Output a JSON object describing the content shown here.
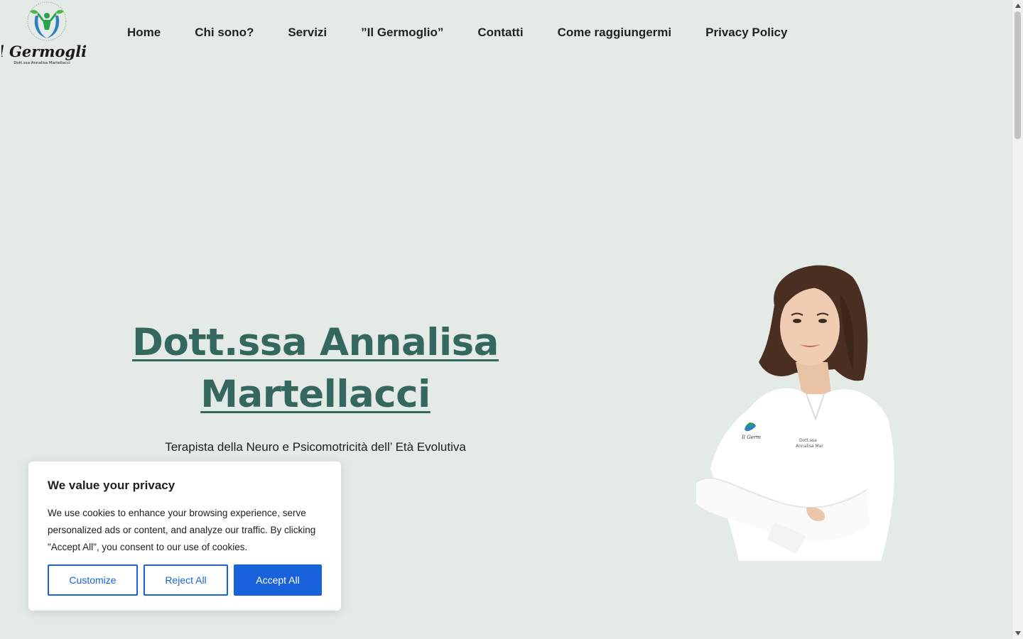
{
  "logo": {
    "title": "Il Germoglio",
    "subtitle": "Dott.ssa Annalisa Martellacci"
  },
  "nav": {
    "items": [
      {
        "label": "Home"
      },
      {
        "label": "Chi sono?"
      },
      {
        "label": "Servizi"
      },
      {
        "label": "”Il Germoglio”"
      },
      {
        "label": "Contatti"
      },
      {
        "label": "Come raggiungermi"
      },
      {
        "label": "Privacy Policy"
      }
    ]
  },
  "hero": {
    "title": "Dott.ssa Annalisa Martellacci",
    "subtitle": "Terapista della Neuro e Psicomotricità dell’ Età Evolutiva"
  },
  "cookie": {
    "title": "We value your privacy",
    "text": "We use cookies to enhance your browsing experience, serve personalized ads or content, and analyze our traffic. By clicking \"Accept All\", you consent to our use of cookies.",
    "customize": "Customize",
    "reject": "Reject All",
    "accept": "Accept All"
  },
  "colors": {
    "background": "#e4ebe7",
    "accent": "#34685c",
    "button_blue": "#1863dc"
  }
}
